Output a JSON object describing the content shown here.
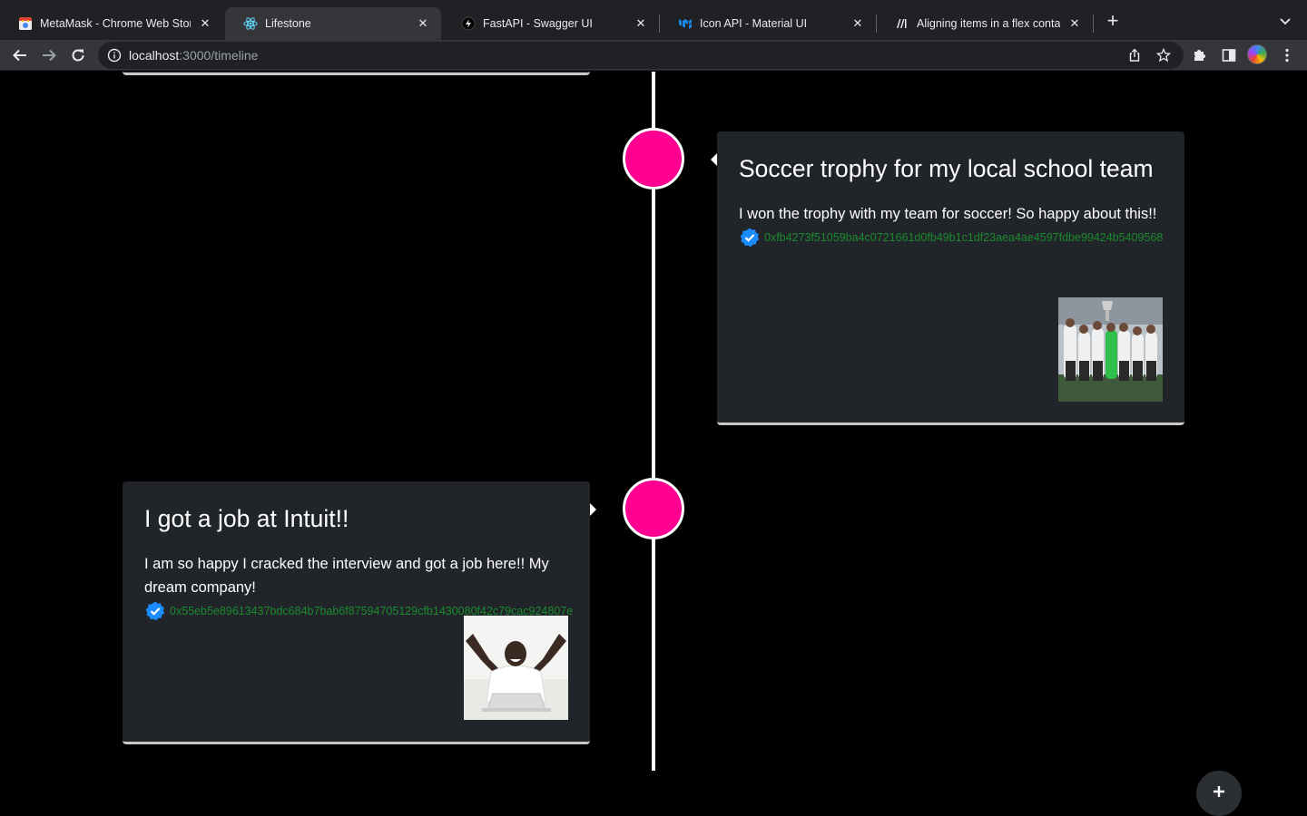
{
  "browser": {
    "tabs": [
      {
        "title": "MetaMask - Chrome Web Store",
        "active": false,
        "favicon": "chrome-web-store-icon"
      },
      {
        "title": "Lifestone",
        "active": true,
        "favicon": "react-icon"
      },
      {
        "title": "FastAPI - Swagger UI",
        "active": false,
        "favicon": "fastapi-icon"
      },
      {
        "title": "Icon API - Material UI",
        "active": false,
        "favicon": "mui-icon"
      },
      {
        "title": "Aligning items in a flex container",
        "active": false,
        "favicon": "mdn-icon"
      }
    ],
    "url_host": "localhost",
    "url_rest": ":3000/timeline"
  },
  "timeline": {
    "events": [
      {
        "title": "Soccer trophy for my local school team",
        "description": "I won the trophy with my team for soccer! So happy about this!!",
        "hash": "0xfb4273f51059ba4c0721661d0fb49b1c1df23aea4ae4597fdbe99424b5409568",
        "image": "soccer-team-trophy-photo",
        "side": "right"
      },
      {
        "title": "I got a job at Intuit!!",
        "description": "I am so happy I cracked the interview and got a job here!! My dream company!",
        "hash": "0x55eb5e89613437bdc684b7bab6f87594705129cfb1430080f42c79cac924807e",
        "image": "man-celebrating-at-laptop-photo",
        "side": "left"
      }
    ]
  },
  "colors": {
    "node": "#ff0090",
    "card_bg": "#212529",
    "hash_text": "#1a8a2e",
    "verified_badge": "#1a8cff"
  },
  "fab": {
    "icon": "plus-icon"
  }
}
